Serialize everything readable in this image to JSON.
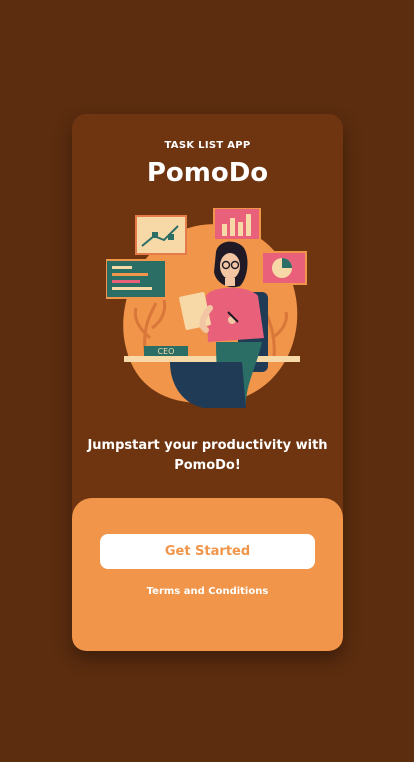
{
  "header": {
    "subtitle": "TASK LIST APP",
    "title": "PomoDo"
  },
  "hero": {
    "desk_label": "CEO"
  },
  "tagline": "Jumpstart your productivity with PomoDo!",
  "actions": {
    "get_started_label": "Get Started",
    "terms_label": "Terms and Conditions"
  },
  "colors": {
    "background": "#5c2d0f",
    "card": "#6f3410",
    "accent": "#f0954a",
    "text": "#ffffff"
  }
}
